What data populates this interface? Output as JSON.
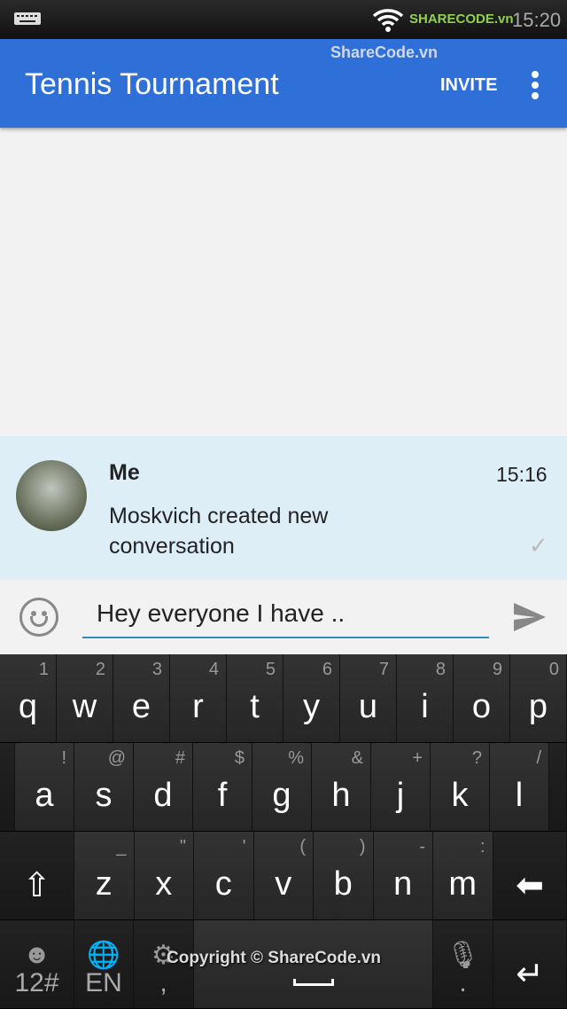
{
  "status_bar": {
    "time": "15:20",
    "watermark_logo": "SHARECODE.vn",
    "icons": [
      "keyboard-icon",
      "wifi-icon",
      "signal-icon",
      "battery-icon"
    ]
  },
  "app_bar": {
    "title": "Tennis Tournament",
    "invite_label": "INVITE",
    "watermark": "ShareCode.vn",
    "bg": "#2f6fd8"
  },
  "message": {
    "sender": "Me",
    "time": "15:16",
    "text": "Moskvich created new conversation"
  },
  "compose": {
    "value": "Hey everyone I have ..",
    "accent": "#2a8ec0"
  },
  "keyboard": {
    "row1": [
      [
        "q",
        "1"
      ],
      [
        "w",
        "2"
      ],
      [
        "e",
        "3"
      ],
      [
        "r",
        "4"
      ],
      [
        "t",
        "5"
      ],
      [
        "y",
        "6"
      ],
      [
        "u",
        "7"
      ],
      [
        "i",
        "8"
      ],
      [
        "o",
        "9"
      ],
      [
        "p",
        "0"
      ]
    ],
    "row2": [
      [
        "a",
        "!"
      ],
      [
        "s",
        "@"
      ],
      [
        "d",
        "#"
      ],
      [
        "f",
        "$"
      ],
      [
        "g",
        "%"
      ],
      [
        "h",
        "&"
      ],
      [
        "j",
        "+"
      ],
      [
        "k",
        "?"
      ],
      [
        "l",
        "/"
      ]
    ],
    "row3": [
      [
        "z",
        "_"
      ],
      [
        "x",
        "\""
      ],
      [
        "c",
        "'"
      ],
      [
        "v",
        "("
      ],
      [
        "b",
        ")"
      ],
      [
        "n",
        "-"
      ],
      [
        "m",
        ":"
      ]
    ],
    "numbers_label": "12#",
    "language_label": "EN",
    "comma": ",",
    "period": ".",
    "copyright": "Copyright © ShareCode.vn"
  }
}
